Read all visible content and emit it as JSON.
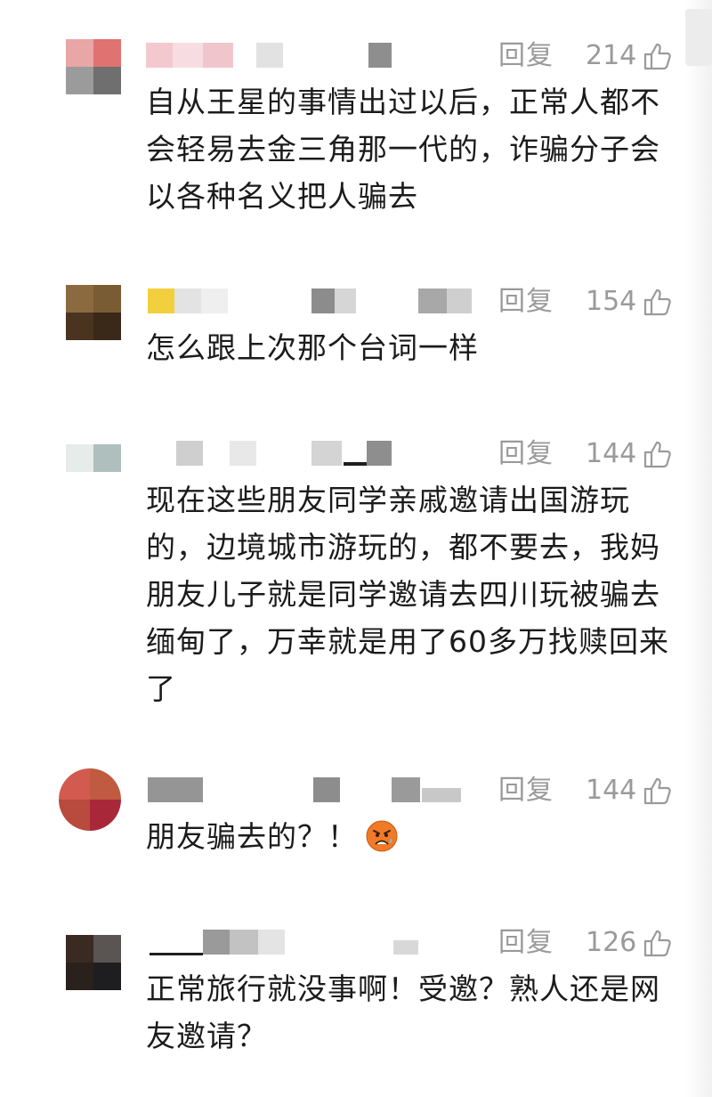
{
  "reply_label": "回复",
  "comments": [
    {
      "likes": "214",
      "text": "自从王星的事情出过以后，正常人都不会轻易去金三角那一代的，诈骗分子会以各种名义把人骗去"
    },
    {
      "likes": "154",
      "text": "怎么跟上次那个台词一样"
    },
    {
      "likes": "144",
      "text": "现在这些朋友同学亲戚邀请出国游玩的，边境城市游玩的，都不要去，我妈朋友儿子就是同学邀请去四川玩被骗去缅甸了，万幸就是用了60多万找赎回来了"
    },
    {
      "likes": "144",
      "text": "朋友骗去的？！",
      "emoji": "worried-face-emoji"
    },
    {
      "likes": "126",
      "text": "正常旅行就没事啊！受邀？熟人还是网友邀请？"
    }
  ],
  "icons": {
    "like": "thumbs-up-icon"
  },
  "colors": {
    "meta": "#9a9a9a",
    "text": "#1b1b1b",
    "background": "#ffffff"
  }
}
